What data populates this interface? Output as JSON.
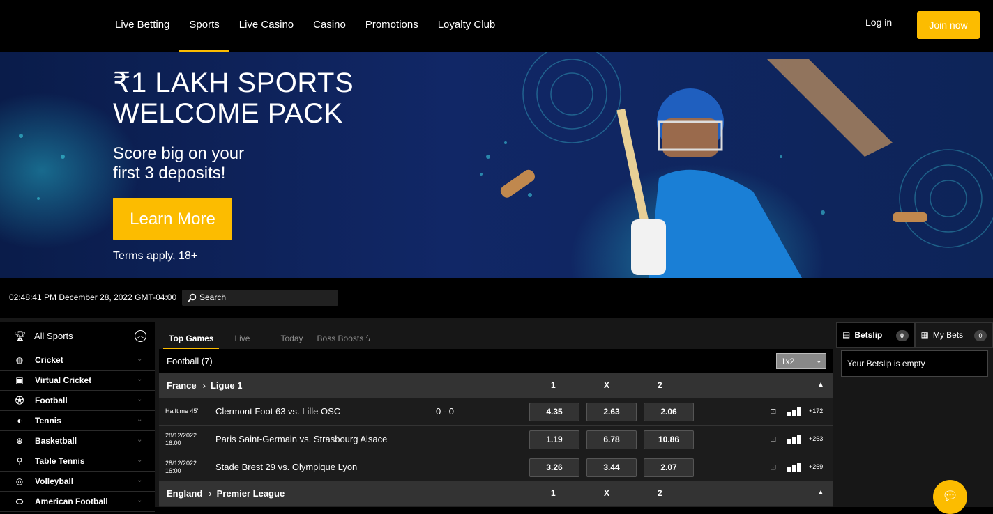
{
  "nav": {
    "links": [
      "Live Betting",
      "Sports",
      "Live Casino",
      "Casino",
      "Promotions",
      "Loyalty Club"
    ],
    "active": "Sports",
    "login": "Log in",
    "join": "Join now"
  },
  "hero": {
    "title_line1": "₹1 LAKH SPORTS",
    "title_line2": "WELCOME PACK",
    "sub_line1": "Score big on your",
    "sub_line2": "first 3 deposits!",
    "cta": "Learn More",
    "terms": "Terms apply, 18+"
  },
  "toolbar": {
    "clock": "02:48:41 PM December 28, 2022 GMT-04:00",
    "search_label": "Search"
  },
  "sidebar": {
    "title": "All Sports",
    "items": [
      {
        "label": "Cricket",
        "icon": "cricket-ball-icon"
      },
      {
        "label": "Virtual Cricket",
        "icon": "virtual-cricket-icon"
      },
      {
        "label": "Football",
        "icon": "football-icon"
      },
      {
        "label": "Tennis",
        "icon": "tennis-icon"
      },
      {
        "label": "Basketball",
        "icon": "basketball-icon"
      },
      {
        "label": "Table Tennis",
        "icon": "table-tennis-icon"
      },
      {
        "label": "Volleyball",
        "icon": "volleyball-icon"
      },
      {
        "label": "American Football",
        "icon": "american-football-icon"
      }
    ]
  },
  "tabs": [
    "Top Games",
    "Live",
    "Today",
    "Boss Boosts"
  ],
  "sport": {
    "title": "Football (7)",
    "market": "1x2"
  },
  "leagues": [
    {
      "country": "France",
      "name": "Ligue 1",
      "headers": [
        "1",
        "X",
        "2"
      ],
      "events": [
        {
          "time1": "Halftime 45'",
          "time2": "",
          "name": "Clermont Foot 63 vs. Lille OSC",
          "score": "0 - 0",
          "odds": [
            "4.35",
            "2.63",
            "2.06"
          ],
          "more": "+172"
        },
        {
          "time1": "28/12/2022",
          "time2": "16:00",
          "name": "Paris Saint-Germain vs. Strasbourg Alsace",
          "score": "",
          "odds": [
            "1.19",
            "6.78",
            "10.86"
          ],
          "more": "+263"
        },
        {
          "time1": "28/12/2022",
          "time2": "16:00",
          "name": "Stade Brest 29 vs. Olympique Lyon",
          "score": "",
          "odds": [
            "3.26",
            "3.44",
            "2.07"
          ],
          "more": "+269"
        }
      ]
    },
    {
      "country": "England",
      "name": "Premier League",
      "headers": [
        "1",
        "X",
        "2"
      ],
      "events": []
    }
  ],
  "betslip": {
    "tab1": "Betslip",
    "tab1_count": "0",
    "tab2": "My Bets",
    "tab2_count": "0",
    "empty": "Your Betslip is empty"
  },
  "colors": {
    "accent": "#fcbc00",
    "background": "#000000",
    "panel": "#171717"
  }
}
